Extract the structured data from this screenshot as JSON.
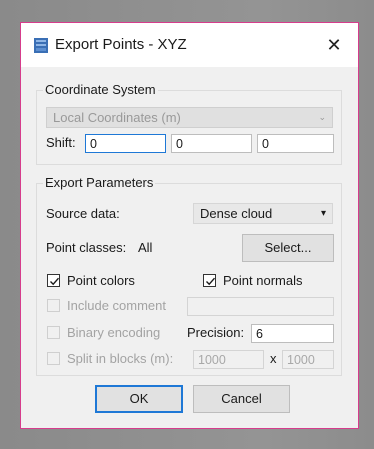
{
  "window": {
    "title": "Export Points - XYZ",
    "close_glyph": "✕",
    "icon": "app-window-icon"
  },
  "coordinate_system": {
    "legend": "Coordinate System",
    "selected": "Local Coordinates (m)",
    "shift_label": "Shift:",
    "shift_values": [
      "0",
      "0",
      "0"
    ]
  },
  "export_parameters": {
    "legend": "Export Parameters",
    "source_label": "Source data:",
    "source_value": "Dense cloud",
    "point_classes_label": "Point classes:",
    "point_classes_value": "All",
    "select_button": "Select...",
    "point_colors": {
      "label": "Point colors",
      "checked": true
    },
    "point_normals": {
      "label": "Point normals",
      "checked": true
    },
    "include_comment": {
      "label": "Include comment",
      "checked": false,
      "enabled": false,
      "value": ""
    },
    "binary_encoding": {
      "label": "Binary encoding",
      "checked": false,
      "enabled": false
    },
    "precision_label": "Precision:",
    "precision_value": "6",
    "split_blocks": {
      "label": "Split in blocks (m):",
      "checked": false,
      "enabled": false,
      "x_value": "1000",
      "y_value": "1000",
      "separator": "x"
    }
  },
  "buttons": {
    "ok": "OK",
    "cancel": "Cancel"
  },
  "colors": {
    "accent": "#1e78d6",
    "window_border": "#d63c8c",
    "icon": "#3a6fb5"
  }
}
